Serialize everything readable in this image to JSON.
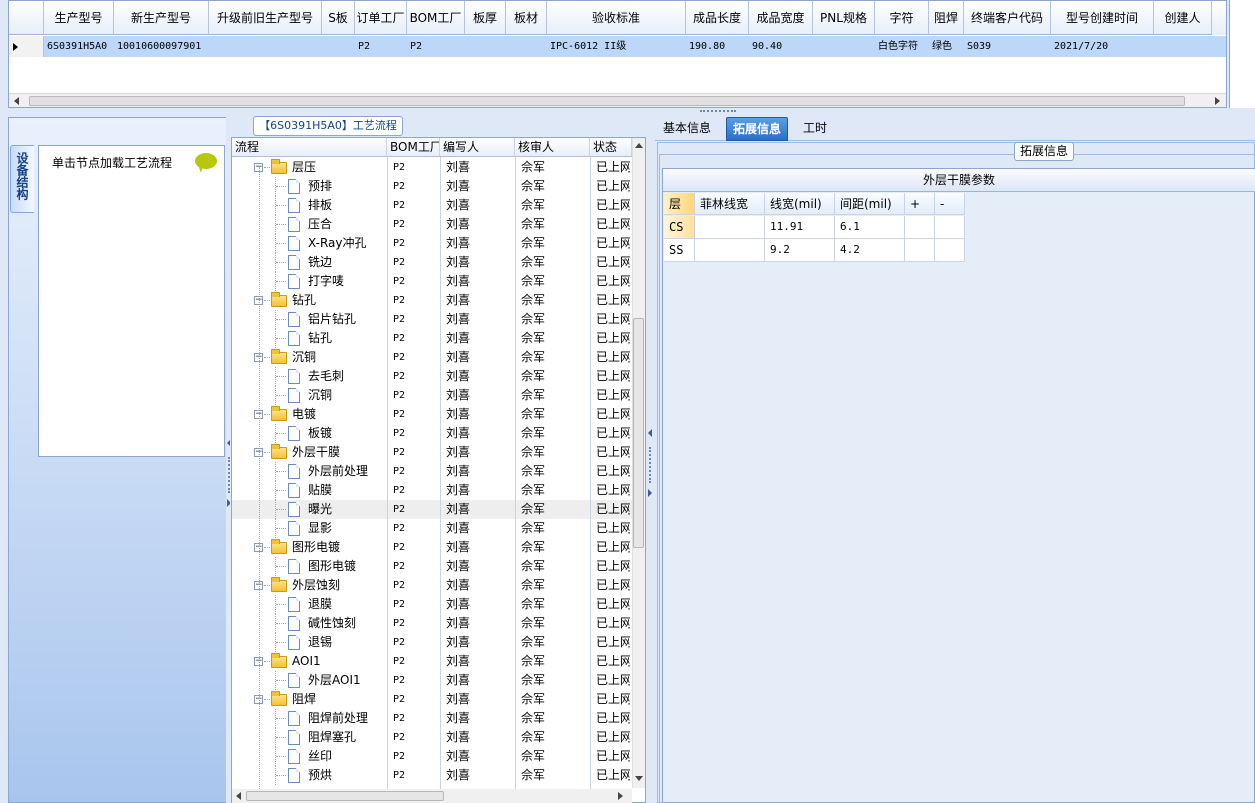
{
  "top_grid": {
    "columns": [
      "生产型号",
      "新生产型号",
      "升级前旧生产型号",
      "S板",
      "订单工厂",
      "BOM工厂",
      "板厚",
      "板材",
      "验收标准",
      "成品长度",
      "成品宽度",
      "PNL规格",
      "字符",
      "阻焊",
      "终端客户代码",
      "型号创建时间",
      "创建人"
    ],
    "row": [
      "6S0391H5A0",
      "10010600097901",
      "",
      "",
      "P2",
      "P2",
      "",
      "",
      "IPC-6012 II级",
      "190.80",
      "90.40",
      "",
      "白色字符",
      "绿色",
      "S039",
      "2021/7/20",
      ""
    ]
  },
  "left_panel": {
    "side_tab_label": "设备结构",
    "load_hint": "单击节点加载工艺流程"
  },
  "process_tree": {
    "title": "【6S0391H5A0】工艺流程",
    "columns": [
      "流程",
      "BOM工厂",
      "编写人",
      "核审人",
      "状态"
    ],
    "rows": [
      {
        "level": 0,
        "name": "层压",
        "bom": "P2",
        "writer": "刘喜",
        "reviewer": "佘军",
        "status": "已上网"
      },
      {
        "level": 1,
        "name": "预排",
        "bom": "P2",
        "writer": "刘喜",
        "reviewer": "佘军",
        "status": "已上网"
      },
      {
        "level": 1,
        "name": "排板",
        "bom": "P2",
        "writer": "刘喜",
        "reviewer": "佘军",
        "status": "已上网"
      },
      {
        "level": 1,
        "name": "压合",
        "bom": "P2",
        "writer": "刘喜",
        "reviewer": "佘军",
        "status": "已上网"
      },
      {
        "level": 1,
        "name": "X-Ray冲孔",
        "bom": "P2",
        "writer": "刘喜",
        "reviewer": "佘军",
        "status": "已上网"
      },
      {
        "level": 1,
        "name": "铣边",
        "bom": "P2",
        "writer": "刘喜",
        "reviewer": "佘军",
        "status": "已上网"
      },
      {
        "level": 1,
        "name": "打字唛",
        "bom": "P2",
        "writer": "刘喜",
        "reviewer": "佘军",
        "status": "已上网"
      },
      {
        "level": 0,
        "name": "钻孔",
        "bom": "P2",
        "writer": "刘喜",
        "reviewer": "佘军",
        "status": "已上网"
      },
      {
        "level": 1,
        "name": "铝片钻孔",
        "bom": "P2",
        "writer": "刘喜",
        "reviewer": "佘军",
        "status": "已上网"
      },
      {
        "level": 1,
        "name": "钻孔",
        "bom": "P2",
        "writer": "刘喜",
        "reviewer": "佘军",
        "status": "已上网"
      },
      {
        "level": 0,
        "name": "沉铜",
        "bom": "P2",
        "writer": "刘喜",
        "reviewer": "佘军",
        "status": "已上网"
      },
      {
        "level": 1,
        "name": "去毛刺",
        "bom": "P2",
        "writer": "刘喜",
        "reviewer": "佘军",
        "status": "已上网"
      },
      {
        "level": 1,
        "name": "沉铜",
        "bom": "P2",
        "writer": "刘喜",
        "reviewer": "佘军",
        "status": "已上网"
      },
      {
        "level": 0,
        "name": "电镀",
        "bom": "P2",
        "writer": "刘喜",
        "reviewer": "佘军",
        "status": "已上网"
      },
      {
        "level": 1,
        "name": "板镀",
        "bom": "P2",
        "writer": "刘喜",
        "reviewer": "佘军",
        "status": "已上网"
      },
      {
        "level": 0,
        "name": "外层干膜",
        "bom": "P2",
        "writer": "刘喜",
        "reviewer": "佘军",
        "status": "已上网"
      },
      {
        "level": 1,
        "name": "外层前处理",
        "bom": "P2",
        "writer": "刘喜",
        "reviewer": "佘军",
        "status": "已上网"
      },
      {
        "level": 1,
        "name": "贴膜",
        "bom": "P2",
        "writer": "刘喜",
        "reviewer": "佘军",
        "status": "已上网"
      },
      {
        "level": 1,
        "name": "曝光",
        "bom": "P2",
        "writer": "刘喜",
        "reviewer": "佘军",
        "status": "已上网",
        "selected": true
      },
      {
        "level": 1,
        "name": "显影",
        "bom": "P2",
        "writer": "刘喜",
        "reviewer": "佘军",
        "status": "已上网"
      },
      {
        "level": 0,
        "name": "图形电镀",
        "bom": "P2",
        "writer": "刘喜",
        "reviewer": "佘军",
        "status": "已上网"
      },
      {
        "level": 1,
        "name": "图形电镀",
        "bom": "P2",
        "writer": "刘喜",
        "reviewer": "佘军",
        "status": "已上网"
      },
      {
        "level": 0,
        "name": "外层蚀刻",
        "bom": "P2",
        "writer": "刘喜",
        "reviewer": "佘军",
        "status": "已上网"
      },
      {
        "level": 1,
        "name": "退膜",
        "bom": "P2",
        "writer": "刘喜",
        "reviewer": "佘军",
        "status": "已上网"
      },
      {
        "level": 1,
        "name": "碱性蚀刻",
        "bom": "P2",
        "writer": "刘喜",
        "reviewer": "佘军",
        "status": "已上网"
      },
      {
        "level": 1,
        "name": "退锡",
        "bom": "P2",
        "writer": "刘喜",
        "reviewer": "佘军",
        "status": "已上网"
      },
      {
        "level": 0,
        "name": "AOI1",
        "bom": "P2",
        "writer": "刘喜",
        "reviewer": "佘军",
        "status": "已上网"
      },
      {
        "level": 1,
        "name": "外层AOI1",
        "bom": "P2",
        "writer": "刘喜",
        "reviewer": "佘军",
        "status": "已上网"
      },
      {
        "level": 0,
        "name": "阻焊",
        "bom": "P2",
        "writer": "刘喜",
        "reviewer": "佘军",
        "status": "已上网"
      },
      {
        "level": 1,
        "name": "阻焊前处理",
        "bom": "P2",
        "writer": "刘喜",
        "reviewer": "佘军",
        "status": "已上网"
      },
      {
        "level": 1,
        "name": "阻焊塞孔",
        "bom": "P2",
        "writer": "刘喜",
        "reviewer": "佘军",
        "status": "已上网"
      },
      {
        "level": 1,
        "name": "丝印",
        "bom": "P2",
        "writer": "刘喜",
        "reviewer": "佘军",
        "status": "已上网"
      },
      {
        "level": 1,
        "name": "预烘",
        "bom": "P2",
        "writer": "刘喜",
        "reviewer": "佘军",
        "status": "已上网"
      }
    ]
  },
  "right_panel": {
    "tabs": [
      "基本信息",
      "拓展信息",
      "工时"
    ],
    "active_tab": "拓展信息",
    "section_legend": "拓展信息",
    "table_title": "外层干膜参数",
    "columns": [
      "层",
      "菲林线宽",
      "线宽(mil)",
      "间距(mil)",
      "+",
      "-"
    ],
    "rows": [
      [
        "CS",
        "",
        "11.91",
        "6.1",
        "",
        ""
      ],
      [
        "SS",
        "",
        "9.2",
        "4.2",
        "",
        ""
      ]
    ]
  },
  "colors": {
    "selection": "#bcd7f7",
    "active_tab": "#2d6fc6",
    "panel_bg": "#dfe8f6",
    "border": "#8ca7cf"
  }
}
